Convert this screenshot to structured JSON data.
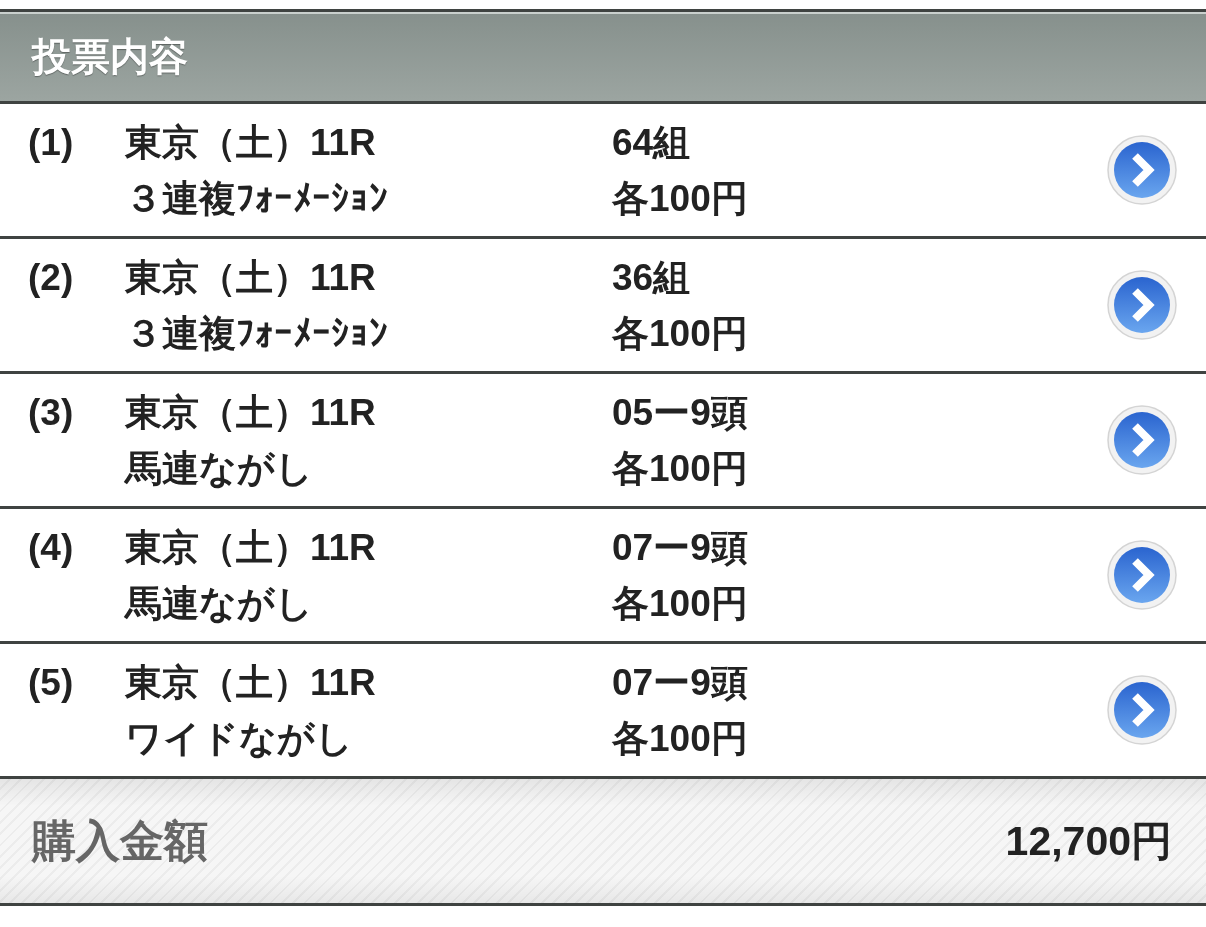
{
  "section_title": "投票内容",
  "bets": [
    {
      "number": "(1)",
      "race": "東京（土）11R",
      "bet_type": "３連複ﾌｫｰﾒｰｼｮﾝ",
      "count": "64組",
      "unit_price": "各100円"
    },
    {
      "number": "(2)",
      "race": "東京（土）11R",
      "bet_type": "３連複ﾌｫｰﾒｰｼｮﾝ",
      "count": "36組",
      "unit_price": "各100円"
    },
    {
      "number": "(3)",
      "race": "東京（土）11R",
      "bet_type": "馬連ながし",
      "count": "05ー9頭",
      "unit_price": "各100円"
    },
    {
      "number": "(4)",
      "race": "東京（土）11R",
      "bet_type": "馬連ながし",
      "count": "07ー9頭",
      "unit_price": "各100円"
    },
    {
      "number": "(5)",
      "race": "東京（土）11R",
      "bet_type": "ワイドながし",
      "count": "07ー9頭",
      "unit_price": "各100円"
    }
  ],
  "total": {
    "label": "購入金額",
    "amount": "12,700円"
  }
}
